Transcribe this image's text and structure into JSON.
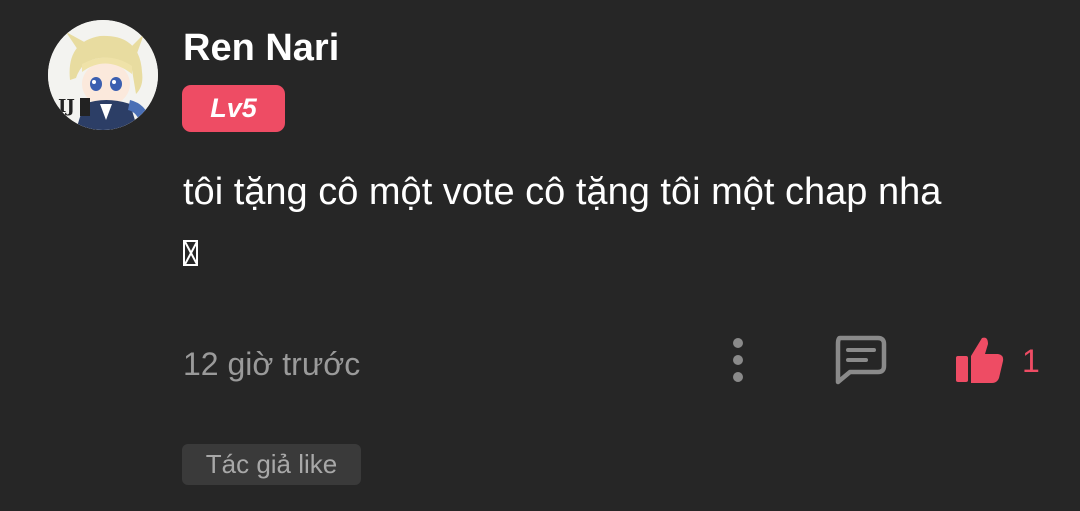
{
  "comment": {
    "username": "Ren Nari",
    "level": "Lv5",
    "text": "tôi tặng cô một vote cô tặng tôi một chap nha",
    "timestamp": "12 giờ trước",
    "like_count": "1",
    "author_like_label": "Tác giả like"
  },
  "colors": {
    "background": "#262626",
    "accent": "#ee4c64",
    "muted_text": "#9a9a9a"
  },
  "icons": {
    "avatar": "anime-character-avatar",
    "emoji": "missing-glyph-box",
    "more": "vertical-ellipsis-icon",
    "reply": "comment-bubble-icon",
    "like": "thumbs-up-icon"
  }
}
